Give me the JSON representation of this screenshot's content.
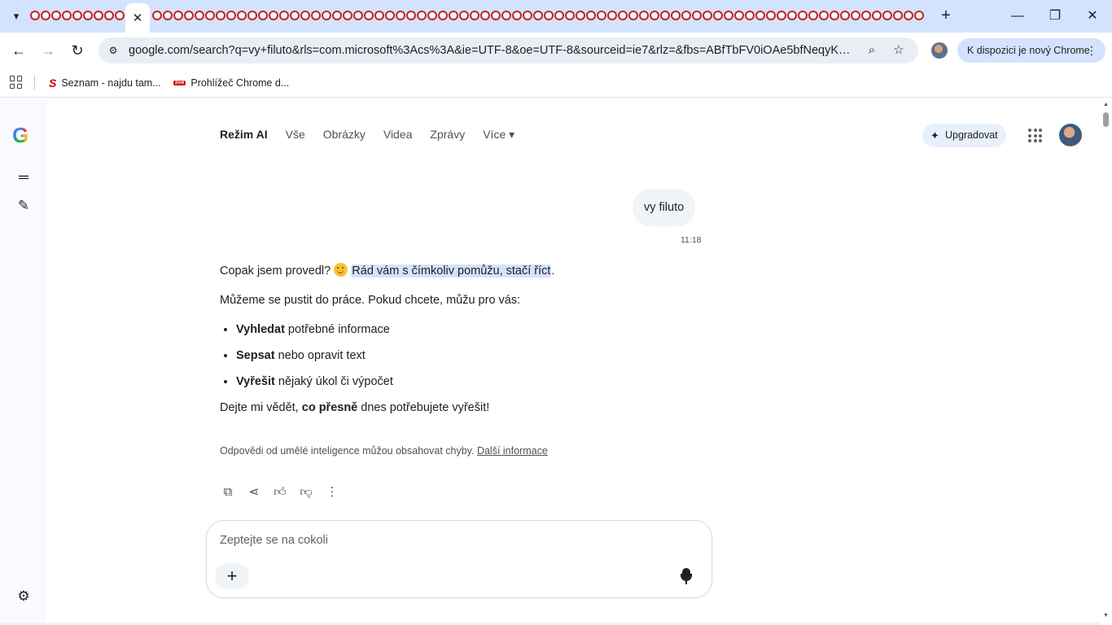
{
  "browser": {
    "active_tab_close": "✕",
    "new_tab": "+",
    "window_controls": {
      "minimize": "—",
      "restore": "❐",
      "close": "✕"
    },
    "url": "google.com/search?q=vy+filuto&rls=com.microsoft%3Acs%3A&ie=UTF-8&oe=UTF-8&sourceid=ie7&rlz=&fbs=ABfTbFV0iOAe5bfNeqyKguX...",
    "update_chip": "K dispozici je nový Chrome",
    "icons": [
      "tab-search-icon",
      "back-icon",
      "forward-icon",
      "reload-icon",
      "site-info-icon",
      "zoom-icon",
      "bookmark-star-icon",
      "kebab-menu-icon"
    ]
  },
  "bookmarks": [
    {
      "label": "Seznam - najdu tam..."
    },
    {
      "label": "Prohlížeč Chrome d..."
    }
  ],
  "nav": {
    "tabs": [
      {
        "label": "Režim AI",
        "active": true
      },
      {
        "label": "Vše"
      },
      {
        "label": "Obrázky"
      },
      {
        "label": "Videa"
      },
      {
        "label": "Zprávy"
      },
      {
        "label": "Více ▾"
      }
    ],
    "upgrade": "Upgradovat"
  },
  "chat": {
    "user_message": "vy filuto",
    "time": "11:18",
    "answer": {
      "line1_pre": "Copak jsem provedl?",
      "line1_highlight": "Rád vám s čímkoliv pomůžu, stačí říct",
      "line1_post": ".",
      "line2": "Můžeme se pustit do práce. Pokud chcete, můžu pro vás:",
      "bullets": [
        {
          "bold": "Vyhledat",
          "rest": " potřebné informace"
        },
        {
          "bold": "Sepsat",
          "rest": " nebo opravit text"
        },
        {
          "bold": "Vyřešit",
          "rest": " nějaký úkol či výpočet"
        }
      ],
      "closing_pre": "Dejte mi vědět, ",
      "closing_bold": "co přesně",
      "closing_post": " dnes potřebujete vyřešit!"
    },
    "disclaimer": "Odpovědi od umělé inteligence můžou obsahovat chyby.",
    "disclaimer_link": "Další informace"
  },
  "composer": {
    "placeholder": "Zeptejte se na cokoli",
    "value": ""
  },
  "colors": {
    "tabstrip": "#d3e3fd",
    "omnibox": "#e9eef6",
    "highlight": "#d3e3fd",
    "bubble": "#f0f4f9"
  }
}
